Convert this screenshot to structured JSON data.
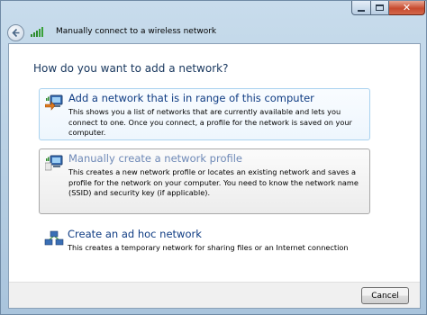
{
  "window": {
    "title": "Manually connect to a wireless network",
    "close_glyph": "✕"
  },
  "main": {
    "heading": "How do you want to add a network?",
    "options": [
      {
        "title": "Add a network that is in range of this computer",
        "description": "This shows you a list of networks that are currently available and lets you connect to one. Once you connect, a profile for the network is saved on your computer.",
        "icon": "network-in-range-icon",
        "state": "selected"
      },
      {
        "title": "Manually create a network profile",
        "description": "This creates a new network profile or locates an existing network and saves a profile for the network on your computer. You need to know the network name (SSID) and security key (if applicable).",
        "icon": "network-profile-icon",
        "state": "hover"
      },
      {
        "title": "Create an ad hoc network",
        "description": "This creates a temporary network for sharing files or an Internet connection",
        "icon": "ad-hoc-network-icon",
        "state": "normal"
      }
    ]
  },
  "footer": {
    "cancel_label": "Cancel"
  },
  "colors": {
    "heading": "#17365d",
    "link_title": "#0f3c83",
    "selected_border": "#a9d2ef",
    "hover_border": "#a8a8a8"
  }
}
